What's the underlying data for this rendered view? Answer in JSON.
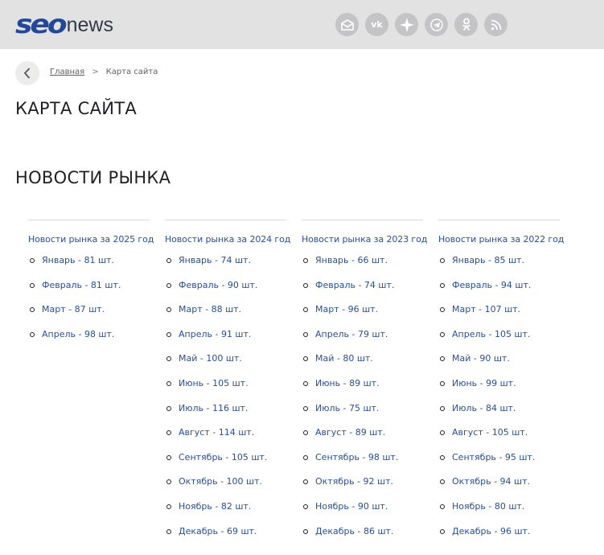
{
  "header": {
    "logo_seo": "seo",
    "logo_news": "news",
    "social_icons": [
      "mail-icon",
      "vk-icon",
      "compass-icon",
      "telegram-icon",
      "odnoklassniki-icon",
      "rss-icon"
    ],
    "vk_text": "vk"
  },
  "breadcrumb": {
    "home": "Главная",
    "separator": ">",
    "current": "Карта сайта"
  },
  "page_title": "КАРТА САЙТА",
  "section_title": "НОВОСТИ РЫНКА",
  "columns": [
    {
      "title": "Новости рынка за 2025 год",
      "items": [
        "Январь - 81 шт.",
        "Февраль - 81 шт.",
        "Март - 87 шт.",
        "Апрель - 98 шт."
      ]
    },
    {
      "title": "Новости рынка за 2024 год",
      "items": [
        "Январь - 74 шт.",
        "Февраль - 90 шт.",
        "Март - 88 шт.",
        "Апрель - 91 шт.",
        "Май - 100 шт.",
        "Июнь - 105 шт.",
        "Июль - 116 шт.",
        "Август - 114 шт.",
        "Сентябрь - 105 шт.",
        "Октябрь - 100 шт.",
        "Ноябрь - 82 шт.",
        "Декабрь - 69 шт."
      ]
    },
    {
      "title": "Новости рынка за 2023 год",
      "items": [
        "Январь - 66 шт.",
        "Февраль - 74 шт.",
        "Март - 96 шт.",
        "Апрель - 79 шт.",
        "Май - 80 шт.",
        "Июнь - 89 шт.",
        "Июль - 75 шт.",
        "Август - 89 шт.",
        "Сентябрь - 98 шт.",
        "Октябрь - 92 шт.",
        "Ноябрь - 90 шт.",
        "Декабрь - 86 шт."
      ]
    },
    {
      "title": "Новости рынка за 2022 год",
      "items": [
        "Январь - 85 шт.",
        "Февраль - 94 шт.",
        "Март - 107 шт.",
        "Апрель - 105 шт.",
        "Май - 90 шт.",
        "Июнь - 99 шт.",
        "Июль - 84 шт.",
        "Август - 105 шт.",
        "Сентябрь - 95 шт.",
        "Октябрь - 94 шт.",
        "Ноябрь - 80 шт.",
        "Декабрь - 96 шт."
      ]
    }
  ],
  "colors": {
    "header_bg": "#e2e2e3",
    "link": "#274f97",
    "logo_blue": "#21489a",
    "icon_bg": "#c4c4c6"
  }
}
